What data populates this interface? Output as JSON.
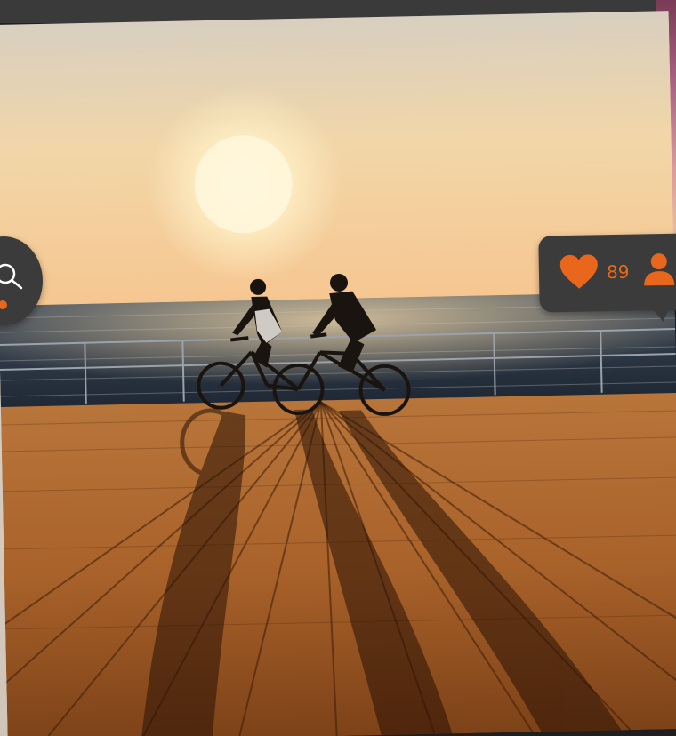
{
  "likes": {
    "count": "89"
  },
  "icons": {
    "search": "search-icon",
    "heart": "heart-icon",
    "user": "user-icon"
  },
  "colors": {
    "accent": "#e8671c",
    "bubble": "#3b3b3b"
  }
}
